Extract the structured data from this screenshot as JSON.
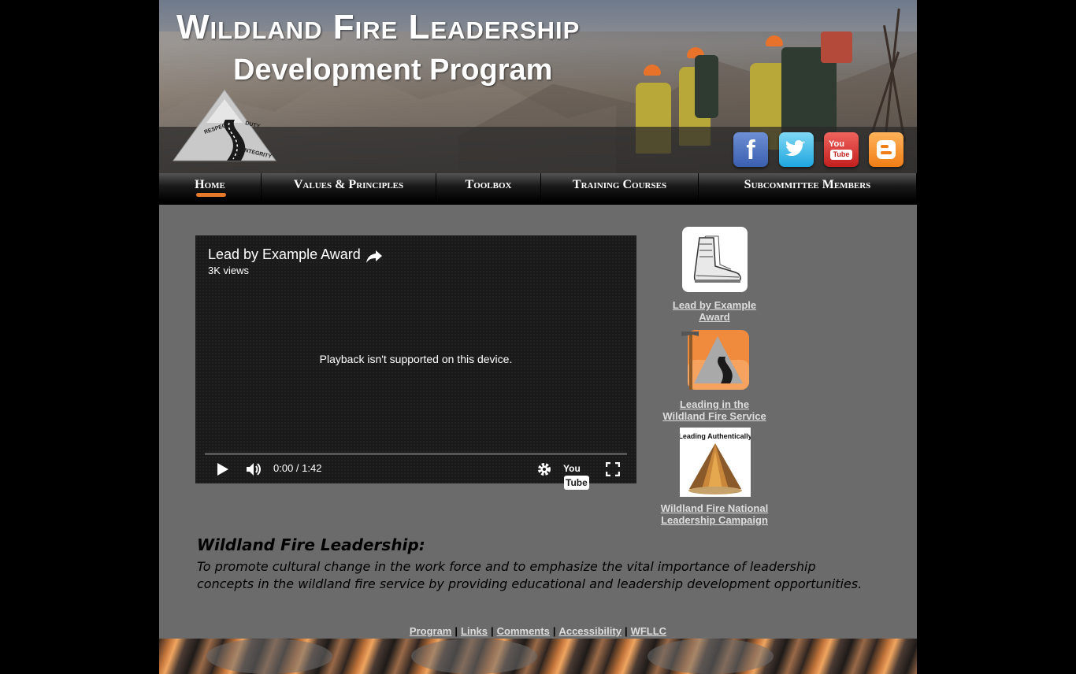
{
  "site": {
    "title": "Wildland Fire Leadership",
    "subtitle": "Development Program",
    "logo_words": [
      "Respect",
      "Duty",
      "Integrity"
    ]
  },
  "social": {
    "facebook": "f",
    "youtube_top": "You",
    "youtube_box": "Tube",
    "blogger": "B"
  },
  "nav": {
    "items": [
      {
        "label": "Home",
        "active": true
      },
      {
        "label": "Values & Principles"
      },
      {
        "label": "Toolbox"
      },
      {
        "label": "Training Courses"
      },
      {
        "label": "Subcommittee Members"
      }
    ],
    "active_color": "#e8782a"
  },
  "video": {
    "title": "Lead by Example Award",
    "views": "3K views",
    "message": "Playback isn't supported on this device.",
    "time": "0:00 / 1:42",
    "yt_logo_1": "You",
    "yt_logo_2": "Tube",
    "icons": [
      "share-icon",
      "play-icon",
      "volume-icon",
      "settings-icon",
      "youtube-logo",
      "fullscreen-icon"
    ]
  },
  "sidebar": {
    "items": [
      {
        "label_line1": "Lead by Example",
        "label_line2": "Award",
        "icon": "boot-icon"
      },
      {
        "label_line1": "Leading in the",
        "label_line2": "Wildland Fire Service",
        "icon": "pulaski-logo-icon"
      },
      {
        "label_line1": "Wildland Fire National",
        "label_line2": "Leadership Campaign",
        "icon": "campaign-logo-icon"
      }
    ],
    "campaign_badge_text": "Leading Authentically"
  },
  "mission": {
    "heading": "Wildland Fire Leadership:",
    "line1": "To promote cultural change in the work force and to emphasize the vital importance of leadership",
    "line2": "concepts in the wildland fire service by providing educational and leadership development opportunities."
  },
  "footer": {
    "links": [
      "Program",
      "Links",
      "Comments",
      "Accessibility",
      "WFLLC"
    ],
    "separator": "|"
  },
  "colors": {
    "page_bg": "#6b6b6b",
    "outer_bg": "#000000",
    "nav_bg": "#000000",
    "link": "#dddddd"
  }
}
